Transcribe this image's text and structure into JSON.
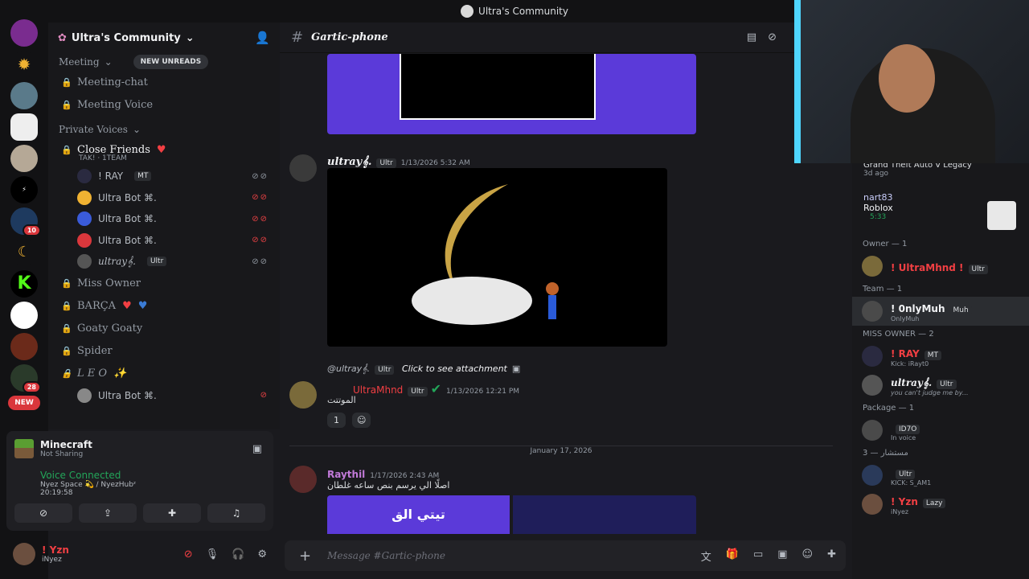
{
  "window": {
    "title": "Ultra's Community"
  },
  "server": {
    "name": "Ultra's Community"
  },
  "rail": {
    "badges": [
      "10",
      "28"
    ],
    "new_label": "NEW"
  },
  "sidebar": {
    "meeting_cat": "Meeting",
    "new_unreads": "NEW UNREADS",
    "meeting_chat": "Meeting-chat",
    "meeting_voice": "Meeting Voice",
    "private_cat": "Private Voices",
    "close_friends": "Close Friends",
    "close_friends_sub": "TAK! · 1TEAM",
    "users": [
      {
        "name": "! RAY",
        "tag": "MT"
      },
      {
        "name": "Ultra Bot ⌘.",
        "tag": ""
      },
      {
        "name": "Ultra Bot ⌘.",
        "tag": ""
      },
      {
        "name": "Ultra Bot ⌘.",
        "tag": ""
      },
      {
        "name": "ultray𝄞.",
        "tag": "Ultr"
      }
    ],
    "miss_owner": "Miss Owner",
    "barca": "BARÇA",
    "goaty": "Goaty Goaty",
    "spider": "Spider",
    "leo": "L E O",
    "leo_user": "Ultra Bot ⌘."
  },
  "activity": {
    "game": "Minecraft",
    "status": "Not Sharing"
  },
  "voice": {
    "connected": "Voice Connected",
    "location": "Nyez Space 💫 / NyezHubᶻ",
    "time": "20:19:58"
  },
  "user": {
    "name": "! Yzn",
    "status": "iNyez"
  },
  "channel": {
    "name": "Gartic-phone"
  },
  "messages": [
    {
      "author": "ultray𝄞.",
      "tag": "Ultr",
      "time": "1/13/2026 5:32 AM"
    },
    {
      "reply_author": "@ultray𝄞.",
      "reply_tag": "Ultr",
      "reply_text": "Click to see attachment",
      "author": "UltraMhnd",
      "tag": "Ultr",
      "time": "1/13/2026 12:21 PM",
      "text": "الموتتت",
      "reaction_count": "1"
    },
    {
      "author": "Raythil",
      "time": "1/17/2026 2:43 AM",
      "text": "اصلًا الي يرسم بنص ساعه غلطان",
      "image_text": "تيتي الق"
    }
  ],
  "divider": {
    "date": "January 17, 2026"
  },
  "composer": {
    "placeholder": "Message #Gartic-phone"
  },
  "members": {
    "top_activity": "Grand Theft Auto V Legacy",
    "top_time": "3d ago",
    "nart": {
      "name": "nart83",
      "game": "Roblox",
      "time": "5:33"
    },
    "owner_hdr": "Owner — 1",
    "owner": {
      "name": "! UltraMhnd !",
      "tag": "Ultr"
    },
    "team_hdr": "Team — 1",
    "team": {
      "name": "! 0nlyMuh",
      "tag": "Muh",
      "sub": "OnlyMuh"
    },
    "miss_hdr": "MISS OWNER — 2",
    "miss1": {
      "name": "! RAY",
      "tag": "MT",
      "sub": "Kick: iRayt0"
    },
    "miss2": {
      "name": "ultray𝄞.",
      "tag": "Ultr",
      "sub": "you can't judge me by..."
    },
    "pkg_hdr": "Package — 1",
    "pkg": {
      "tag": "ID7O",
      "sub": "In voice"
    },
    "mst_hdr": "مستشار — 3",
    "mst1": {
      "tag": "Ultr",
      "sub": "KICK: S_AM1"
    },
    "mst2": {
      "name": "! Yzn",
      "tag": "Lazy",
      "sub": "iNyez"
    }
  }
}
